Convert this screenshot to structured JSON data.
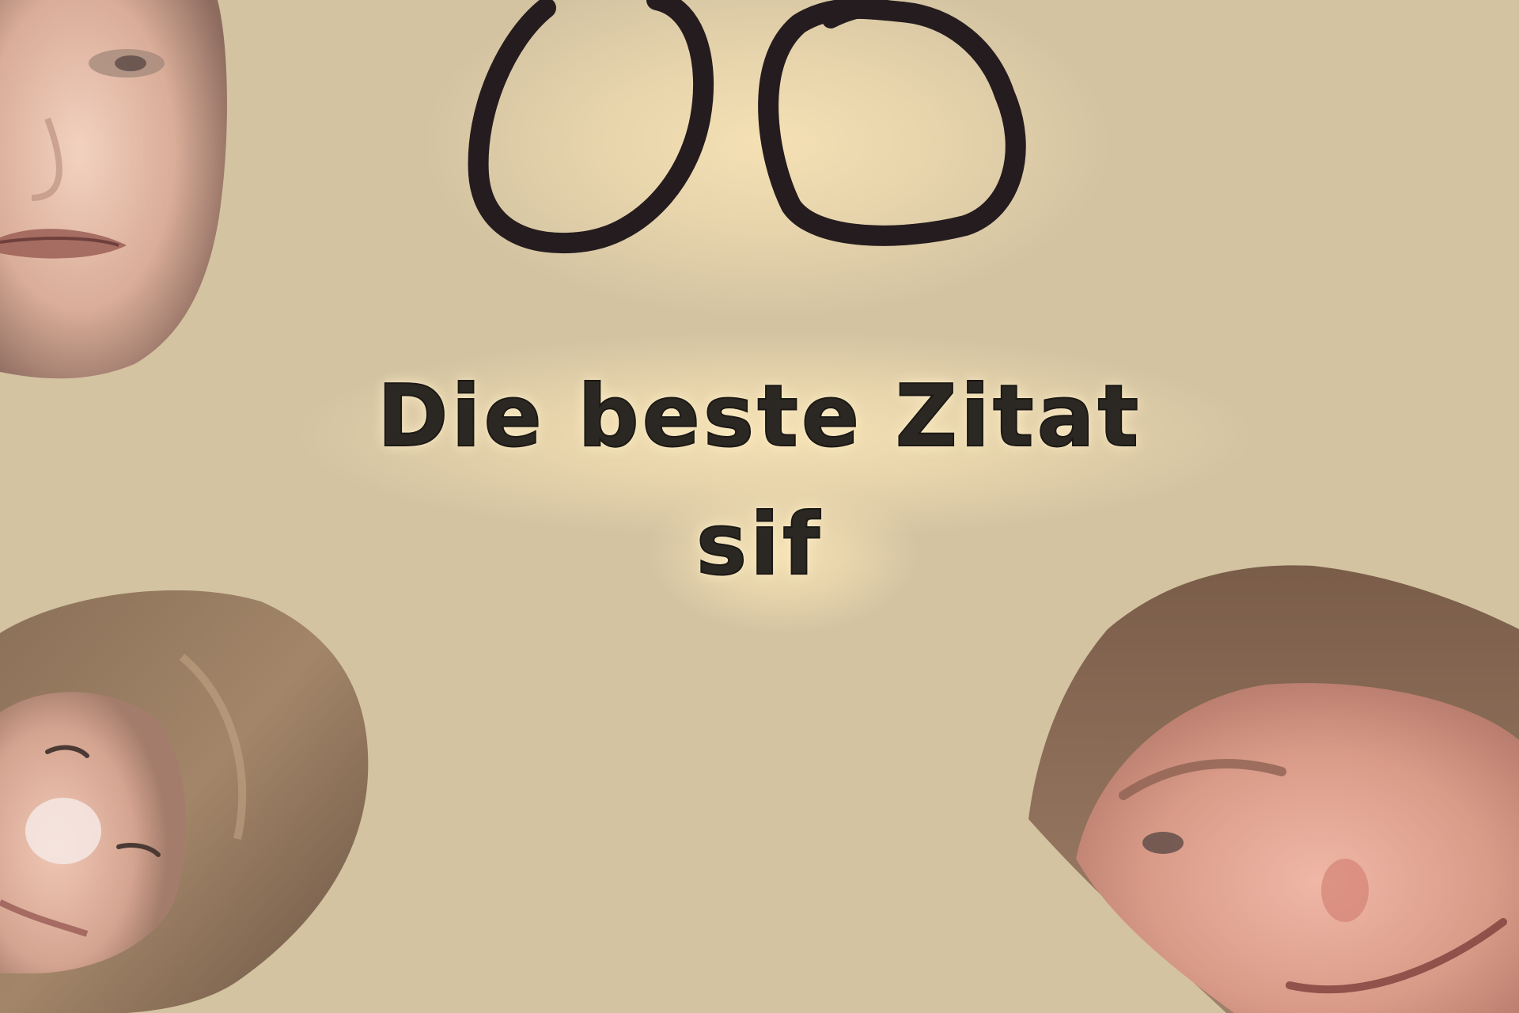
{
  "title": {
    "line1": "Die beste Zitat",
    "line2": "sif"
  },
  "decorations": {
    "doodle": "hand-drawn-double-circle",
    "stickers": [
      "face-sticker-top-left",
      "face-sticker-bottom-left",
      "face-sticker-bottom-right"
    ]
  },
  "colors": {
    "background": "#d3c3a1",
    "text": "#2b2722",
    "doodle_stroke": "#241c1f"
  }
}
